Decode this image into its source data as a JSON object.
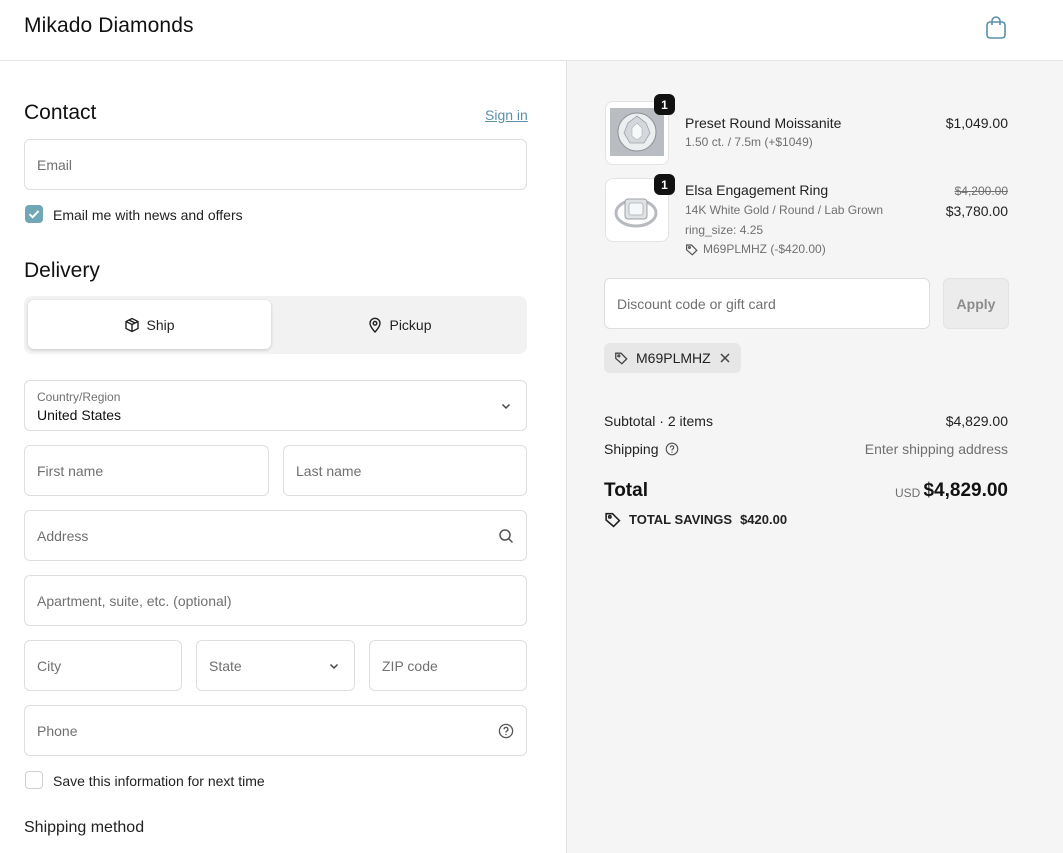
{
  "header": {
    "brand": "Mikado Diamonds",
    "cart_icon": "shopping-bag-icon"
  },
  "contact": {
    "title": "Contact",
    "sign_in": "Sign in",
    "email_placeholder": "Email",
    "newsletter_label": "Email me with news and offers",
    "newsletter_checked": true
  },
  "delivery": {
    "title": "Delivery",
    "methods": [
      {
        "label": "Ship",
        "icon": "box-icon",
        "selected": true
      },
      {
        "label": "Pickup",
        "icon": "map-pin-icon",
        "selected": false
      }
    ],
    "country_label": "Country/Region",
    "country_value": "United States",
    "first_name_placeholder": "First name",
    "last_name_placeholder": "Last name",
    "address_placeholder": "Address",
    "apartment_placeholder": "Apartment, suite, etc. (optional)",
    "city_placeholder": "City",
    "state_placeholder": "State",
    "zip_placeholder": "ZIP code",
    "phone_placeholder": "Phone",
    "save_info_label": "Save this information for next time",
    "save_info_checked": false
  },
  "shipping_method": {
    "title": "Shipping method"
  },
  "order": {
    "items": [
      {
        "qty": "1",
        "name": "Preset Round Moissanite",
        "variant": "1.50 ct. / 7.5m (+$1049)",
        "price": "$1,049.00"
      },
      {
        "qty": "1",
        "name": "Elsa Engagement Ring",
        "variant": "14K White Gold / Round / Lab Grown",
        "property": "ring_size: 4.25",
        "discount": "M69PLMHZ (-$420.00)",
        "compare_price": "$4,200.00",
        "price": "$3,780.00"
      }
    ],
    "discount_placeholder": "Discount code or gift card",
    "apply_label": "Apply",
    "applied_code": "M69PLMHZ",
    "subtotal_label": "Subtotal · 2 items",
    "subtotal_value": "$4,829.00",
    "shipping_label": "Shipping",
    "shipping_value": "Enter shipping address",
    "total_label": "Total",
    "currency": "USD",
    "total_value": "$4,829.00",
    "savings_label": "TOTAL SAVINGS",
    "savings_value": "$420.00"
  },
  "colors": {
    "accent": "#6fa7b6",
    "link": "#5a8fa8",
    "summary_bg": "#f5f5f5"
  }
}
